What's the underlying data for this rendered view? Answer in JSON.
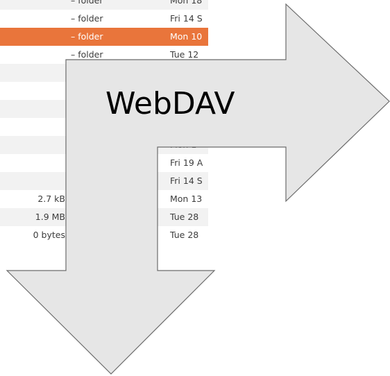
{
  "rows": [
    {
      "size": "",
      "type": "– folder",
      "date": "Mon 18"
    },
    {
      "size": "",
      "type": "– folder",
      "date": "Fri 14 S"
    },
    {
      "size": "",
      "type": "– folder",
      "date": "Mon 10",
      "selected": true
    },
    {
      "size": "",
      "type": "– folder",
      "date": "Tue 12"
    },
    {
      "size": "",
      "type": "–",
      "date": ""
    },
    {
      "size": "",
      "type": "–",
      "date": ""
    },
    {
      "size": "",
      "type": "–",
      "date": ""
    },
    {
      "size": "",
      "type": "–",
      "date": ""
    },
    {
      "size": "",
      "type": "–",
      "date": "Mon 1"
    },
    {
      "size": "",
      "type": "–",
      "date": "Fri 19 A"
    },
    {
      "size": "",
      "type": "–",
      "date": "Fri 14 S"
    },
    {
      "size": "2.7 kB",
      "type": "",
      "date": "Mon 13"
    },
    {
      "size": "1.9 MB",
      "type": "",
      "date": "Tue 28"
    },
    {
      "size": "0 bytes",
      "type": "",
      "date": "Tue 28"
    }
  ],
  "logo": {
    "text": "WebDAV",
    "arrow_fill": "#e6e6e6",
    "arrow_stroke": "#6b6b6b"
  },
  "colors": {
    "selection": "#e9753b",
    "alt_row": "#f2f2f2"
  }
}
